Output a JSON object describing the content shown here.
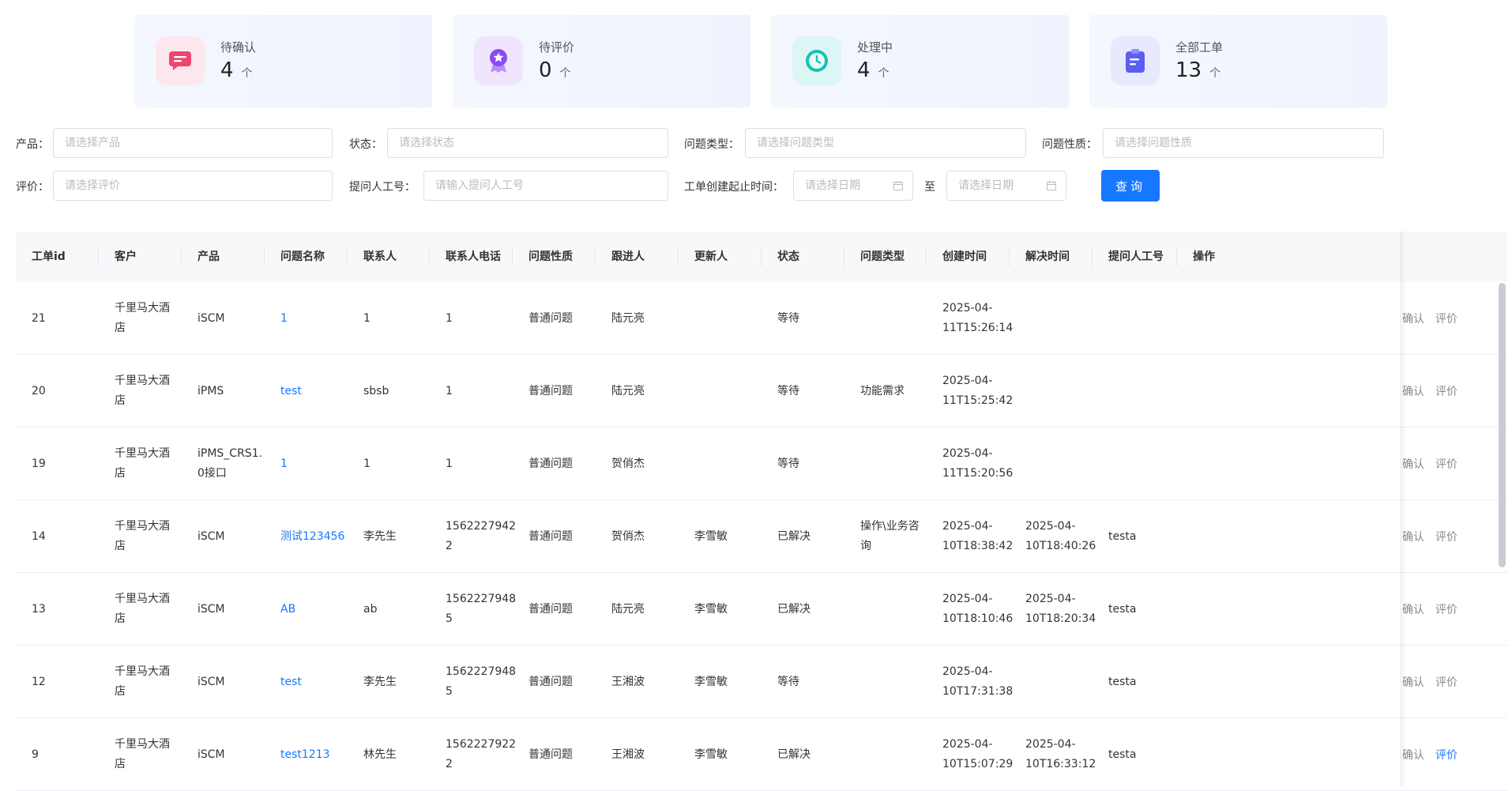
{
  "stats": [
    {
      "label": "待确认",
      "value": "4",
      "unit": "个",
      "icon": "message-icon",
      "bg": "#fde7ee",
      "color": "#f0466e"
    },
    {
      "label": "待评价",
      "value": "0",
      "unit": "个",
      "icon": "award-icon",
      "bg": "#efe6fd",
      "color": "#8b4cf5"
    },
    {
      "label": "处理中",
      "value": "4",
      "unit": "个",
      "icon": "clock-icon",
      "bg": "#dcf6f4",
      "color": "#14c2b5"
    },
    {
      "label": "全部工单",
      "value": "13",
      "unit": "个",
      "icon": "clipboard-icon",
      "bg": "#e8e9fd",
      "color": "#5b5ff0"
    }
  ],
  "filters": {
    "product": {
      "label": "产品：",
      "placeholder": "请选择产品"
    },
    "status": {
      "label": "状态：",
      "placeholder": "请选择状态"
    },
    "issue_type": {
      "label": "问题类型：",
      "placeholder": "请选择问题类型"
    },
    "issue_nature": {
      "label": "问题性质：",
      "placeholder": "请选择问题性质"
    },
    "rating": {
      "label": "评价：",
      "placeholder": "请选择评价"
    },
    "asker_id": {
      "label": "提问人工号：",
      "placeholder": "请输入提问人工号"
    },
    "date_range": {
      "label": "工单创建起止时间：",
      "start_placeholder": "请选择日期",
      "separator": "至",
      "end_placeholder": "请选择日期"
    },
    "query_button": "查询"
  },
  "table": {
    "headers": [
      "工单id",
      "客户",
      "产品",
      "问题名称",
      "联系人",
      "联系人电话",
      "问题性质",
      "跟进人",
      "更新人",
      "状态",
      "问题类型",
      "创建时间",
      "解决时间",
      "提问人工号",
      "操作"
    ],
    "rows": [
      {
        "id": "21",
        "customer": [
          "千里马大酒",
          "店"
        ],
        "product": [
          "iSCM"
        ],
        "name": "1",
        "contact": "1",
        "phone": [
          "1"
        ],
        "nature": "普通问题",
        "follower": "陆元亮",
        "updater": "",
        "status": "等待",
        "type": [
          ""
        ],
        "created": [
          "2025-04-",
          "11T15:26:14"
        ],
        "resolved": [
          "",
          ""
        ],
        "asker": "",
        "op_confirm": "确认",
        "op_rate": "评价",
        "rate_active": false
      },
      {
        "id": "20",
        "customer": [
          "千里马大酒",
          "店"
        ],
        "product": [
          "iPMS"
        ],
        "name": "test",
        "contact": "sbsb",
        "phone": [
          "1"
        ],
        "nature": "普通问题",
        "follower": "陆元亮",
        "updater": "",
        "status": "等待",
        "type": [
          "功能需求"
        ],
        "created": [
          "2025-04-",
          "11T15:25:42"
        ],
        "resolved": [
          "",
          ""
        ],
        "asker": "",
        "op_confirm": "确认",
        "op_rate": "评价",
        "rate_active": false
      },
      {
        "id": "19",
        "customer": [
          "千里马大酒",
          "店"
        ],
        "product": [
          "iPMS_CRS1.",
          "0接口"
        ],
        "name": "1",
        "contact": "1",
        "phone": [
          "1"
        ],
        "nature": "普通问题",
        "follower": "贺俏杰",
        "updater": "",
        "status": "等待",
        "type": [
          ""
        ],
        "created": [
          "2025-04-",
          "11T15:20:56"
        ],
        "resolved": [
          "",
          ""
        ],
        "asker": "",
        "op_confirm": "确认",
        "op_rate": "评价",
        "rate_active": false
      },
      {
        "id": "14",
        "customer": [
          "千里马大酒",
          "店"
        ],
        "product": [
          "iSCM"
        ],
        "name": "测试123456",
        "contact": "李先生",
        "phone": [
          "1562227942",
          "2"
        ],
        "nature": "普通问题",
        "follower": "贺俏杰",
        "updater": "李雪敏",
        "status": "已解决",
        "type": [
          "操作\\业务咨",
          "询"
        ],
        "created": [
          "2025-04-",
          "10T18:38:42"
        ],
        "resolved": [
          "2025-04-",
          "10T18:40:26"
        ],
        "asker": "testa",
        "op_confirm": "确认",
        "op_rate": "评价",
        "rate_active": false
      },
      {
        "id": "13",
        "customer": [
          "千里马大酒",
          "店"
        ],
        "product": [
          "iSCM"
        ],
        "name": "AB",
        "contact": "ab",
        "phone": [
          "1562227948",
          "5"
        ],
        "nature": "普通问题",
        "follower": "陆元亮",
        "updater": "李雪敏",
        "status": "已解决",
        "type": [
          ""
        ],
        "created": [
          "2025-04-",
          "10T18:10:46"
        ],
        "resolved": [
          "2025-04-",
          "10T18:20:34"
        ],
        "asker": "testa",
        "op_confirm": "确认",
        "op_rate": "评价",
        "rate_active": false
      },
      {
        "id": "12",
        "customer": [
          "千里马大酒",
          "店"
        ],
        "product": [
          "iSCM"
        ],
        "name": "test",
        "contact": "李先生",
        "phone": [
          "1562227948",
          "5"
        ],
        "nature": "普通问题",
        "follower": "王湘波",
        "updater": "李雪敏",
        "status": "等待",
        "type": [
          ""
        ],
        "created": [
          "2025-04-",
          "10T17:31:38"
        ],
        "resolved": [
          "",
          ""
        ],
        "asker": "testa",
        "op_confirm": "确认",
        "op_rate": "评价",
        "rate_active": false
      },
      {
        "id": "9",
        "customer": [
          "千里马大酒",
          "店"
        ],
        "product": [
          "iSCM"
        ],
        "name": "test1213",
        "contact": "林先生",
        "phone": [
          "1562227922",
          "2"
        ],
        "nature": "普通问题",
        "follower": "王湘波",
        "updater": "李雪敏",
        "status": "已解决",
        "type": [
          ""
        ],
        "created": [
          "2025-04-",
          "10T15:07:29"
        ],
        "resolved": [
          "2025-04-",
          "10T16:33:12"
        ],
        "asker": "testa",
        "op_confirm": "确认",
        "op_rate": "评价",
        "rate_active": true
      }
    ]
  }
}
